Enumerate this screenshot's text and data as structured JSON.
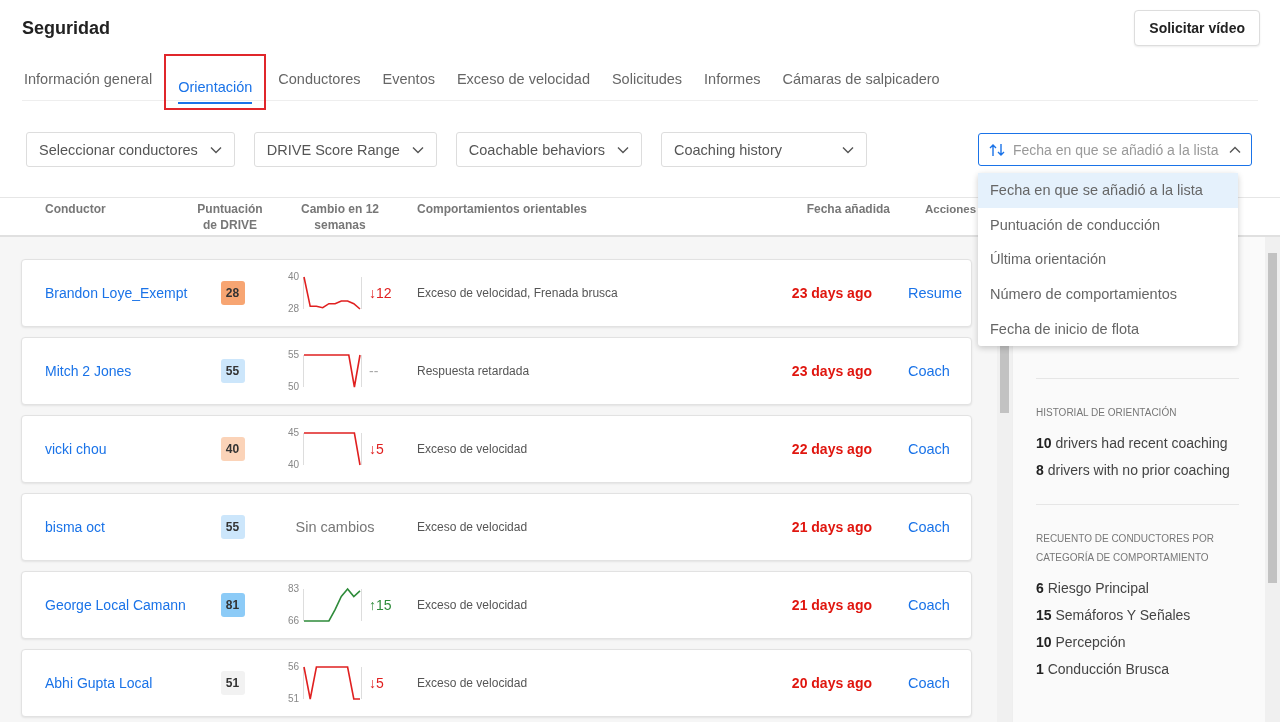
{
  "page_title": "Seguridad",
  "request_button": "Solicitar vídeo",
  "tabs": [
    {
      "label": "Información general",
      "selected": false,
      "highlighted": false
    },
    {
      "label": "Orientación",
      "selected": true,
      "highlighted": true
    },
    {
      "label": "Conductores",
      "selected": false,
      "highlighted": false
    },
    {
      "label": "Eventos",
      "selected": false,
      "highlighted": false
    },
    {
      "label": "Exceso de velocidad",
      "selected": false,
      "highlighted": false
    },
    {
      "label": "Solicitudes",
      "selected": false,
      "highlighted": false
    },
    {
      "label": "Informes",
      "selected": false,
      "highlighted": false
    },
    {
      "label": "Cámaras de salpicadero",
      "selected": false,
      "highlighted": false
    }
  ],
  "filters": [
    {
      "label": "Seleccionar conductores"
    },
    {
      "label": "DRIVE Score Range"
    },
    {
      "label": "Coachable behaviors"
    },
    {
      "label": "Coaching history"
    }
  ],
  "sort": {
    "placeholder": "Fecha en que se añadió a la lista",
    "expanded": true,
    "options": [
      {
        "label": "Fecha en que se añadió a la lista",
        "selected": true
      },
      {
        "label": "Puntuación de conducción",
        "selected": false
      },
      {
        "label": "Última orientación",
        "selected": false
      },
      {
        "label": "Número de comportamientos",
        "selected": false
      },
      {
        "label": "Fecha de inicio de flota",
        "selected": false
      }
    ]
  },
  "table": {
    "columns": [
      "Conductor",
      "Puntuación de DRIVE",
      "Cambio en 12 semanas",
      "Comportamientos orientables",
      "Fecha añadida",
      "Acciones"
    ],
    "rows": [
      {
        "driver": "Brandon Loye_Exempt",
        "score": {
          "value": "28",
          "color": "#f7a572"
        },
        "change": {
          "kind": "down",
          "text": "↓12",
          "chart_data": {
            "type": "line",
            "ylim": [
              28,
              40
            ],
            "yticks": [
              28,
              40
            ],
            "series": [
              {
                "color": "#e02020",
                "values": [
                  40,
                  29,
                  29,
                  28.5,
                  30,
                  30,
                  31,
                  31,
                  30,
                  28
                ]
              }
            ]
          }
        },
        "behaviors": "Exceso de velocidad, Frenada brusca",
        "date": "23 days ago",
        "action": "Resume"
      },
      {
        "driver": "Mitch 2 Jones",
        "score": {
          "value": "55",
          "color": "#cce6fb"
        },
        "change": {
          "kind": "none",
          "text": "--",
          "chart_data": {
            "type": "line",
            "ylim": [
              50,
              55
            ],
            "yticks": [
              50,
              55
            ],
            "series": [
              {
                "color": "#e02020",
                "values": [
                  55,
                  55,
                  55,
                  55,
                  55,
                  55,
                  55,
                  55,
                  55,
                  50,
                  55
                ]
              }
            ]
          }
        },
        "behaviors": "Respuesta retardada",
        "date": "23 days ago",
        "action": "Coach"
      },
      {
        "driver": "vicki chou",
        "score": {
          "value": "40",
          "color": "#fbd3b8"
        },
        "change": {
          "kind": "down",
          "text": "↓5",
          "chart_data": {
            "type": "line",
            "ylim": [
              40,
              45
            ],
            "yticks": [
              40,
              45
            ],
            "series": [
              {
                "color": "#e02020",
                "values": [
                  45,
                  45,
                  45,
                  45,
                  45,
                  45,
                  45,
                  45,
                  45,
                  45,
                  40
                ]
              }
            ]
          }
        },
        "behaviors": "Exceso de velocidad",
        "date": "22 days ago",
        "action": "Coach"
      },
      {
        "driver": "bisma oct",
        "score": {
          "value": "55",
          "color": "#cce6fb"
        },
        "change": {
          "kind": "flat",
          "text": "Sin cambios"
        },
        "behaviors": "Exceso de velocidad",
        "date": "21 days ago",
        "action": "Coach"
      },
      {
        "driver": "George Local Camann",
        "score": {
          "value": "81",
          "color": "#8ccbf7"
        },
        "change": {
          "kind": "up",
          "text": "↑15",
          "chart_data": {
            "type": "line",
            "ylim": [
              66,
              83
            ],
            "yticks": [
              66,
              83
            ],
            "series": [
              {
                "color": "#2e8b3a",
                "values": [
                  66,
                  66,
                  66,
                  66,
                  66,
                  72,
                  79,
                  83,
                  79,
                  82
                ]
              }
            ]
          }
        },
        "behaviors": "Exceso de velocidad",
        "date": "21 days ago",
        "action": "Coach"
      },
      {
        "driver": "Abhi Gupta Local",
        "score": {
          "value": "51",
          "color": "#f2f2f2"
        },
        "change": {
          "kind": "down",
          "text": "↓5",
          "chart_data": {
            "type": "line",
            "ylim": [
              51,
              56
            ],
            "yticks": [
              51,
              56
            ],
            "series": [
              {
                "color": "#e02020",
                "values": [
                  56,
                  51,
                  56,
                  56,
                  56,
                  56,
                  56,
                  56,
                  51,
                  51
                ]
              }
            ]
          }
        },
        "behaviors": "Exceso de velocidad",
        "date": "20 days ago",
        "action": "Coach"
      }
    ]
  },
  "sidebar": {
    "sections": [
      {
        "title": "HISTORIAL DE ORIENTACIÓN",
        "items": [
          {
            "count": "10",
            "label": "drivers had recent coaching"
          },
          {
            "count": "8",
            "label": "drivers with no prior coaching"
          }
        ]
      },
      {
        "title": "RECUENTO DE CONDUCTORES POR CATEGORÍA DE COMPORTAMIENTO",
        "items": [
          {
            "count": "6",
            "label": "Riesgo Principal"
          },
          {
            "count": "15",
            "label": "Semáforos Y Señales"
          },
          {
            "count": "10",
            "label": "Percepción"
          },
          {
            "count": "1",
            "label": "Conducción Brusca"
          }
        ]
      }
    ]
  }
}
